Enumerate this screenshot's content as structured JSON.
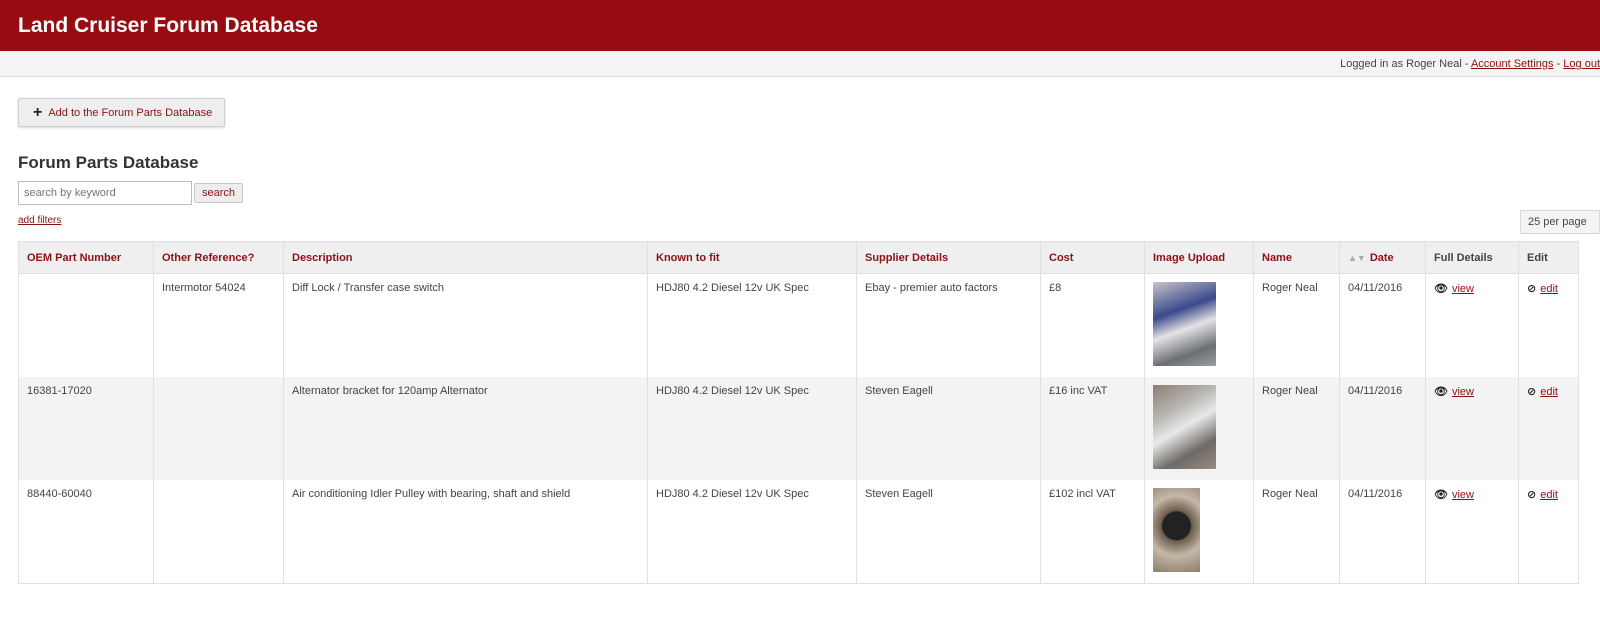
{
  "header": {
    "title": "Land Cruiser Forum Database"
  },
  "userbar": {
    "logged_in_text": "Logged in as Roger Neal - ",
    "account_settings": "Account Settings",
    "separator": " - ",
    "logout": "Log out"
  },
  "toolbar": {
    "add_label": "Add to the Forum Parts Database"
  },
  "section": {
    "title": "Forum Parts Database"
  },
  "search": {
    "placeholder": "search by keyword",
    "button": "search"
  },
  "filters": {
    "add_filters": "add filters"
  },
  "pagination": {
    "per_page": "25 per page"
  },
  "table": {
    "columns": [
      "OEM Part Number",
      "Other Reference?",
      "Description",
      "Known to fit",
      "Supplier Details",
      "Cost",
      "Image Upload",
      "Name",
      "Date",
      "Full Details",
      "Edit"
    ],
    "rows": [
      {
        "oem": "",
        "other_ref": "Intermotor 54024",
        "description": "Diff Lock / Transfer case switch",
        "fits": "HDJ80 4.2 Diesel 12v UK Spec",
        "supplier": "Ebay - premier auto factors",
        "cost": "£8",
        "name": "Roger Neal",
        "date": "04/11/2016",
        "view": "view",
        "edit": "edit"
      },
      {
        "oem": "16381-17020",
        "other_ref": "",
        "description": "Alternator bracket for 120amp Alternator",
        "fits": "HDJ80 4.2 Diesel 12v UK Spec",
        "supplier": "Steven Eagell",
        "cost": "£16 inc VAT",
        "name": "Roger Neal",
        "date": "04/11/2016",
        "view": "view",
        "edit": "edit"
      },
      {
        "oem": "88440-60040",
        "other_ref": "",
        "description": "Air conditioning Idler Pulley with bearing, shaft and shield",
        "fits": "HDJ80 4.2 Diesel 12v UK Spec",
        "supplier": "Steven Eagell",
        "cost": "£102 incl VAT",
        "name": "Roger Neal",
        "date": "04/11/2016",
        "view": "view",
        "edit": "edit"
      }
    ]
  },
  "colors": {
    "brand": "#960c10",
    "link": "#8d1014"
  },
  "icons": {
    "add": "plus-icon",
    "view": "eye-icon",
    "edit": "ban-icon",
    "sort": "sort-icon"
  }
}
